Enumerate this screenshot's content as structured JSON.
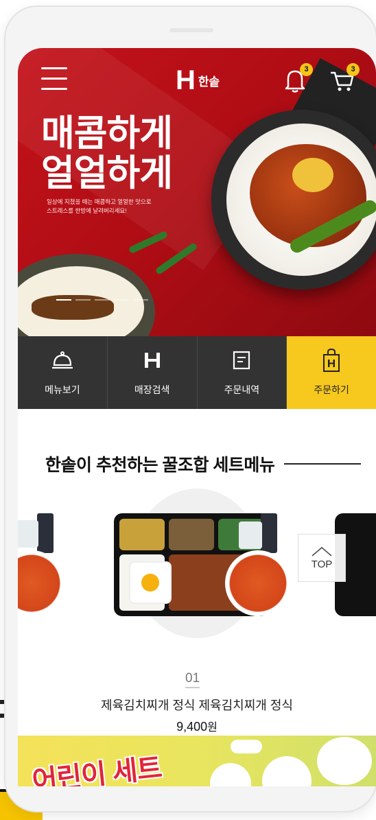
{
  "header": {
    "logo_mark": "H",
    "logo_text": "한솥",
    "notification_count": "3",
    "cart_count": "3"
  },
  "hero": {
    "title_line1": "매콤하게",
    "title_line2": "얼얼하게",
    "subtitle_line1": "일상에 지쳤을 때는 매콤하고 얼얼한 맛으로",
    "subtitle_line2": "스트레스를 한방에 날려버리세요!"
  },
  "quick_menu": [
    {
      "label": "메뉴보기",
      "icon": "cloche-icon"
    },
    {
      "label": "매장검색",
      "icon": "store-logo-icon"
    },
    {
      "label": "주문내역",
      "icon": "receipt-icon"
    },
    {
      "label": "주문하기",
      "icon": "shopping-bag-icon"
    }
  ],
  "recommend": {
    "title": "한솥이 추천하는 꿀조합 세트메뉴",
    "index": "01",
    "item_name": "제육김치찌개 정식 제육김치찌개 정식",
    "price": "9,400",
    "currency": "원"
  },
  "top_button": {
    "label": "TOP"
  },
  "kids_banner": {
    "title": "어린이 세트"
  },
  "colors": {
    "brand_red": "#c4131b",
    "accent_yellow": "#f7c81e",
    "quickbar_dark": "#333333"
  }
}
